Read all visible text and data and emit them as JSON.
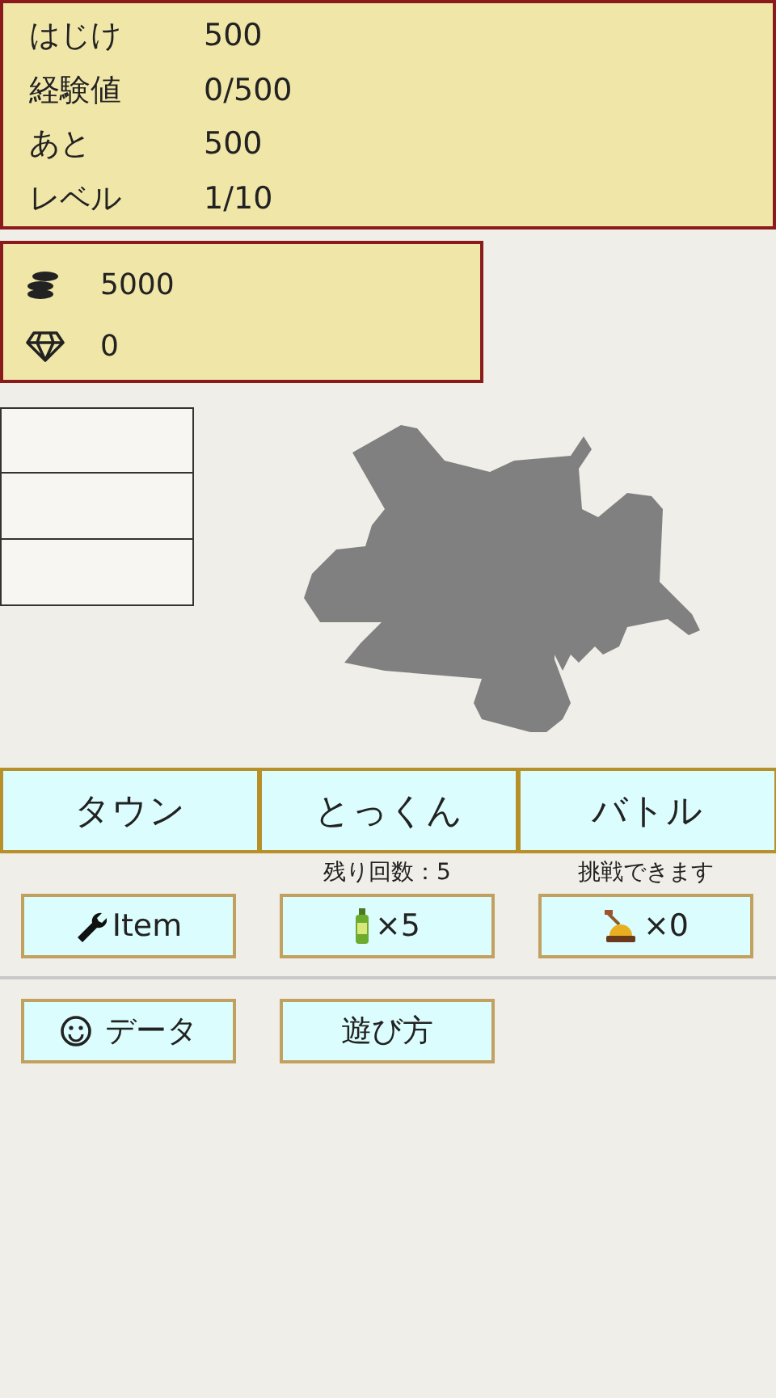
{
  "stats": [
    {
      "label": "はじけ",
      "value": "500"
    },
    {
      "label": "経験値",
      "value": "0/500"
    },
    {
      "label": "あと",
      "value": "500"
    },
    {
      "label": "レベル",
      "value": "1/10"
    }
  ],
  "currency": [
    {
      "kind": "coins",
      "value": "5000"
    },
    {
      "kind": "gem",
      "value": "0"
    }
  ],
  "slots": [
    {
      "kind": "empty"
    },
    {
      "kind": "empty"
    },
    {
      "kind": "empty"
    }
  ],
  "tabs": [
    {
      "label": "タウン",
      "selected": false
    },
    {
      "label": "とっくん",
      "selected": false
    },
    {
      "label": "バトル",
      "selected": false
    }
  ],
  "actions": [
    {
      "kind": "wrench",
      "label": "Item"
    },
    {
      "note": "残り回数：5",
      "kind": "bottle",
      "label": "×5"
    },
    {
      "note": "挑戦できます",
      "kind": "bell",
      "label": "×0"
    }
  ],
  "menu": [
    {
      "kind": "smiley",
      "label": "データ"
    },
    {
      "kind": "plain",
      "label": "遊び方"
    }
  ]
}
